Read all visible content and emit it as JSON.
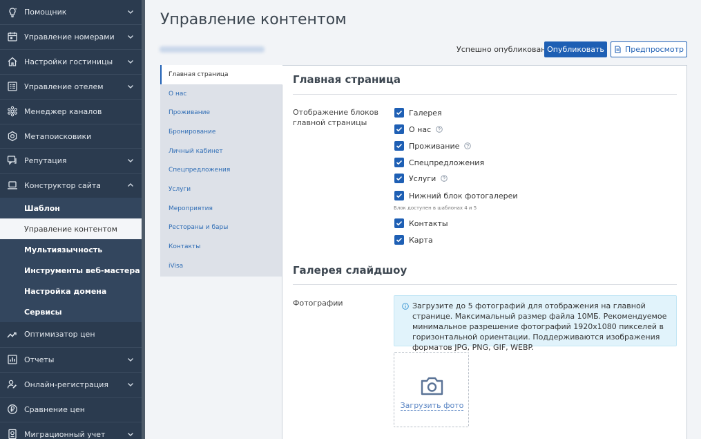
{
  "sidebar": {
    "items": [
      {
        "label": "Помощник",
        "icon": "lightbulb-icon"
      },
      {
        "label": "Управление номерами",
        "icon": "calendar-icon"
      },
      {
        "label": "Настройки гостиницы",
        "icon": "home-icon"
      },
      {
        "label": "Управление отелем",
        "icon": "list-icon"
      },
      {
        "label": "Менеджер каналов",
        "icon": "hub-icon"
      },
      {
        "label": "Метапоисковики",
        "icon": "target-icon"
      },
      {
        "label": "Репутация",
        "icon": "comment-icon"
      },
      {
        "label": "Конструктор сайта",
        "icon": "laptop-icon"
      }
    ],
    "subitems": [
      {
        "label": "Шаблон"
      },
      {
        "label": "Управление контентом"
      },
      {
        "label": "Мультиязычность"
      },
      {
        "label": "Инструменты веб-мастера"
      },
      {
        "label": "Настройка домена"
      },
      {
        "label": "Сервисы"
      }
    ],
    "items_after": [
      {
        "label": "Оптимизатор цен",
        "icon": "trend-icon"
      },
      {
        "label": "Отчеты",
        "icon": "chart-icon"
      },
      {
        "label": "Онлайн-регистрация",
        "icon": "user-edit-icon"
      },
      {
        "label": "Сравнение цен",
        "icon": "ruble-icon"
      },
      {
        "label": "Миграционный учет",
        "icon": "passport-icon"
      }
    ]
  },
  "header": {
    "title": "Управление контентом",
    "status": "Успешно опубликовано",
    "publish_label": "Опубликовать",
    "preview_label": "Предпросмотр"
  },
  "tabs": [
    {
      "label": "Главная страница"
    },
    {
      "label": "О нас"
    },
    {
      "label": "Проживание"
    },
    {
      "label": "Бронирование"
    },
    {
      "label": "Личный кабинет"
    },
    {
      "label": "Спецпредложения"
    },
    {
      "label": "Услуги"
    },
    {
      "label": "Мероприятия"
    },
    {
      "label": "Рестораны и бары"
    },
    {
      "label": "Контакты"
    },
    {
      "label": "iVisa"
    }
  ],
  "main": {
    "section1_title": "Главная страница",
    "blocks_label": "Отображение блоков главной страницы",
    "blocks": [
      {
        "label": "Галерея",
        "checked": true
      },
      {
        "label": "О нас",
        "checked": true,
        "help": true
      },
      {
        "label": "Проживание",
        "checked": true,
        "help": true
      },
      {
        "label": "Спецпредложения",
        "checked": true
      },
      {
        "label": "Услуги",
        "checked": true,
        "help": true
      },
      {
        "label": "Нижний блок фотогалереи",
        "checked": true
      },
      {
        "label": "Контакты",
        "checked": true
      },
      {
        "label": "Карта",
        "checked": true
      }
    ],
    "blocks_hint": "Блок доступен в шаблонах 4 и 5",
    "section2_title": "Галерея слайдшоу",
    "photos_label": "Фотографии",
    "info_text": "Загрузите до 5 фотографий для отображения на главной странице. Максимальный размер файла 10МБ. Рекомендуемое минимальное разрешение фотографий 1920x1080 пикселей в горизонтальной ориентации. Поддерживаются изображения форматов JPG, PNG, GIF, WEBP.",
    "upload_label": "Загрузить фото"
  },
  "colors": {
    "sidebar_bg": "#2b3b4f",
    "accent": "#1e5fb4",
    "info_bg": "#e1f3fb"
  }
}
